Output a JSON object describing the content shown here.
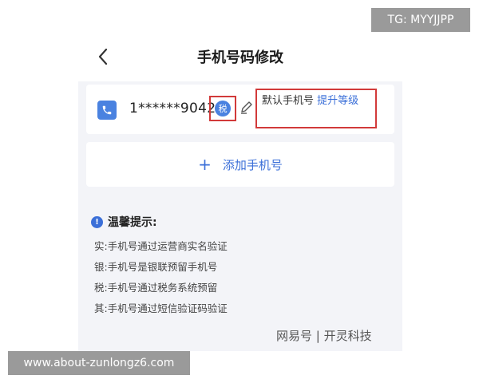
{
  "header": {
    "title": "手机号码修改"
  },
  "phone_card": {
    "number": "1******9042",
    "tax_badge": "税",
    "default_label": "默认手机号",
    "upgrade_label": "提升等级"
  },
  "add_phone": {
    "plus": "+",
    "label": "添加手机号"
  },
  "tips": {
    "icon": "!",
    "heading": "温馨提示:",
    "lines": [
      "实:手机号通过运营商实名验证",
      "银:手机号是银联预留手机号",
      "税:手机号通过税务系统预留",
      "其:手机号通过短信验证码验证"
    ]
  },
  "watermark": "网易号 | 开灵科技",
  "overlays": {
    "tg": "TG: MYYJJPP",
    "url": "www.about-zunlongz6.com"
  },
  "colors": {
    "accent": "#3b6fd8",
    "highlight_box": "#d23a3a",
    "page_bg": "#f3f4f8"
  }
}
